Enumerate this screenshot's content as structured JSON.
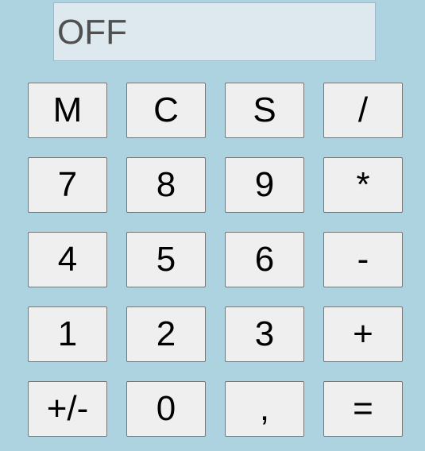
{
  "display": {
    "value": "OFF"
  },
  "keys": [
    {
      "label": "M",
      "name": "memory-button"
    },
    {
      "label": "C",
      "name": "clear-button"
    },
    {
      "label": "S",
      "name": "s-button"
    },
    {
      "label": "/",
      "name": "divide-button"
    },
    {
      "label": "7",
      "name": "digit-7-button"
    },
    {
      "label": "8",
      "name": "digit-8-button"
    },
    {
      "label": "9",
      "name": "digit-9-button"
    },
    {
      "label": "*",
      "name": "multiply-button"
    },
    {
      "label": "4",
      "name": "digit-4-button"
    },
    {
      "label": "5",
      "name": "digit-5-button"
    },
    {
      "label": "6",
      "name": "digit-6-button"
    },
    {
      "label": "-",
      "name": "subtract-button"
    },
    {
      "label": "1",
      "name": "digit-1-button"
    },
    {
      "label": "2",
      "name": "digit-2-button"
    },
    {
      "label": "3",
      "name": "digit-3-button"
    },
    {
      "label": "+",
      "name": "add-button"
    },
    {
      "label": "+/-",
      "name": "sign-toggle-button"
    },
    {
      "label": "0",
      "name": "digit-0-button"
    },
    {
      "label": ",",
      "name": "decimal-comma-button"
    },
    {
      "label": "=",
      "name": "equals-button"
    }
  ]
}
